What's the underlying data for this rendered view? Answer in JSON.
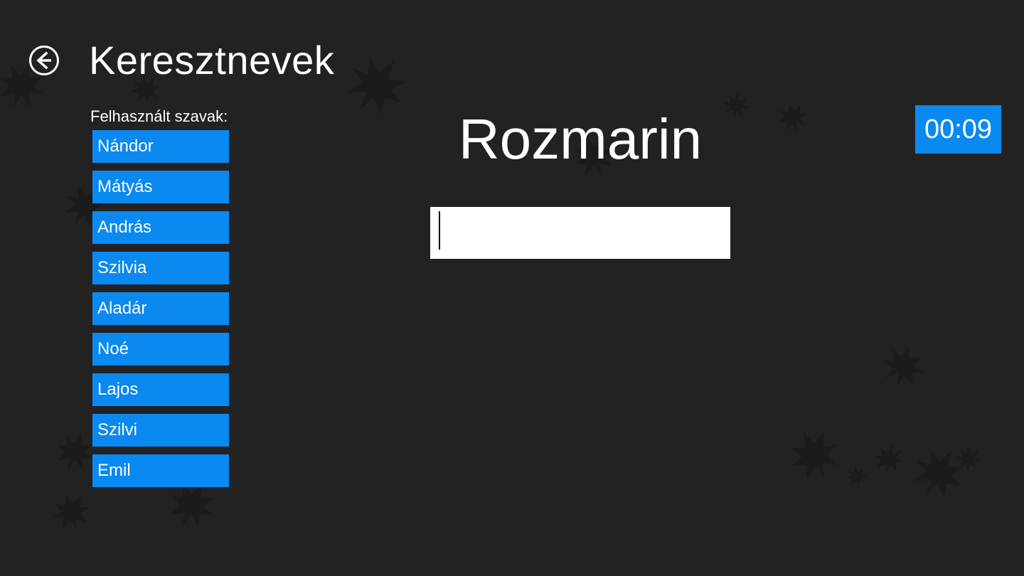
{
  "header": {
    "title": "Keresztnevek",
    "back_icon": "arrow-left-circle-icon"
  },
  "sidebar": {
    "label": "Felhasznált szavak:",
    "words": [
      "Nándor",
      "Mátyás",
      "András",
      "Szilvia",
      "Aladár",
      "Noé",
      "Lajos",
      "Szilvi",
      "Emil"
    ]
  },
  "main": {
    "current_word": "Rozmarin",
    "input_value": ""
  },
  "timer": {
    "value": "00:09"
  },
  "colors": {
    "background": "#222222",
    "accent": "#0a89f0",
    "text": "#ffffff",
    "leaf": "#1a1a1a"
  }
}
